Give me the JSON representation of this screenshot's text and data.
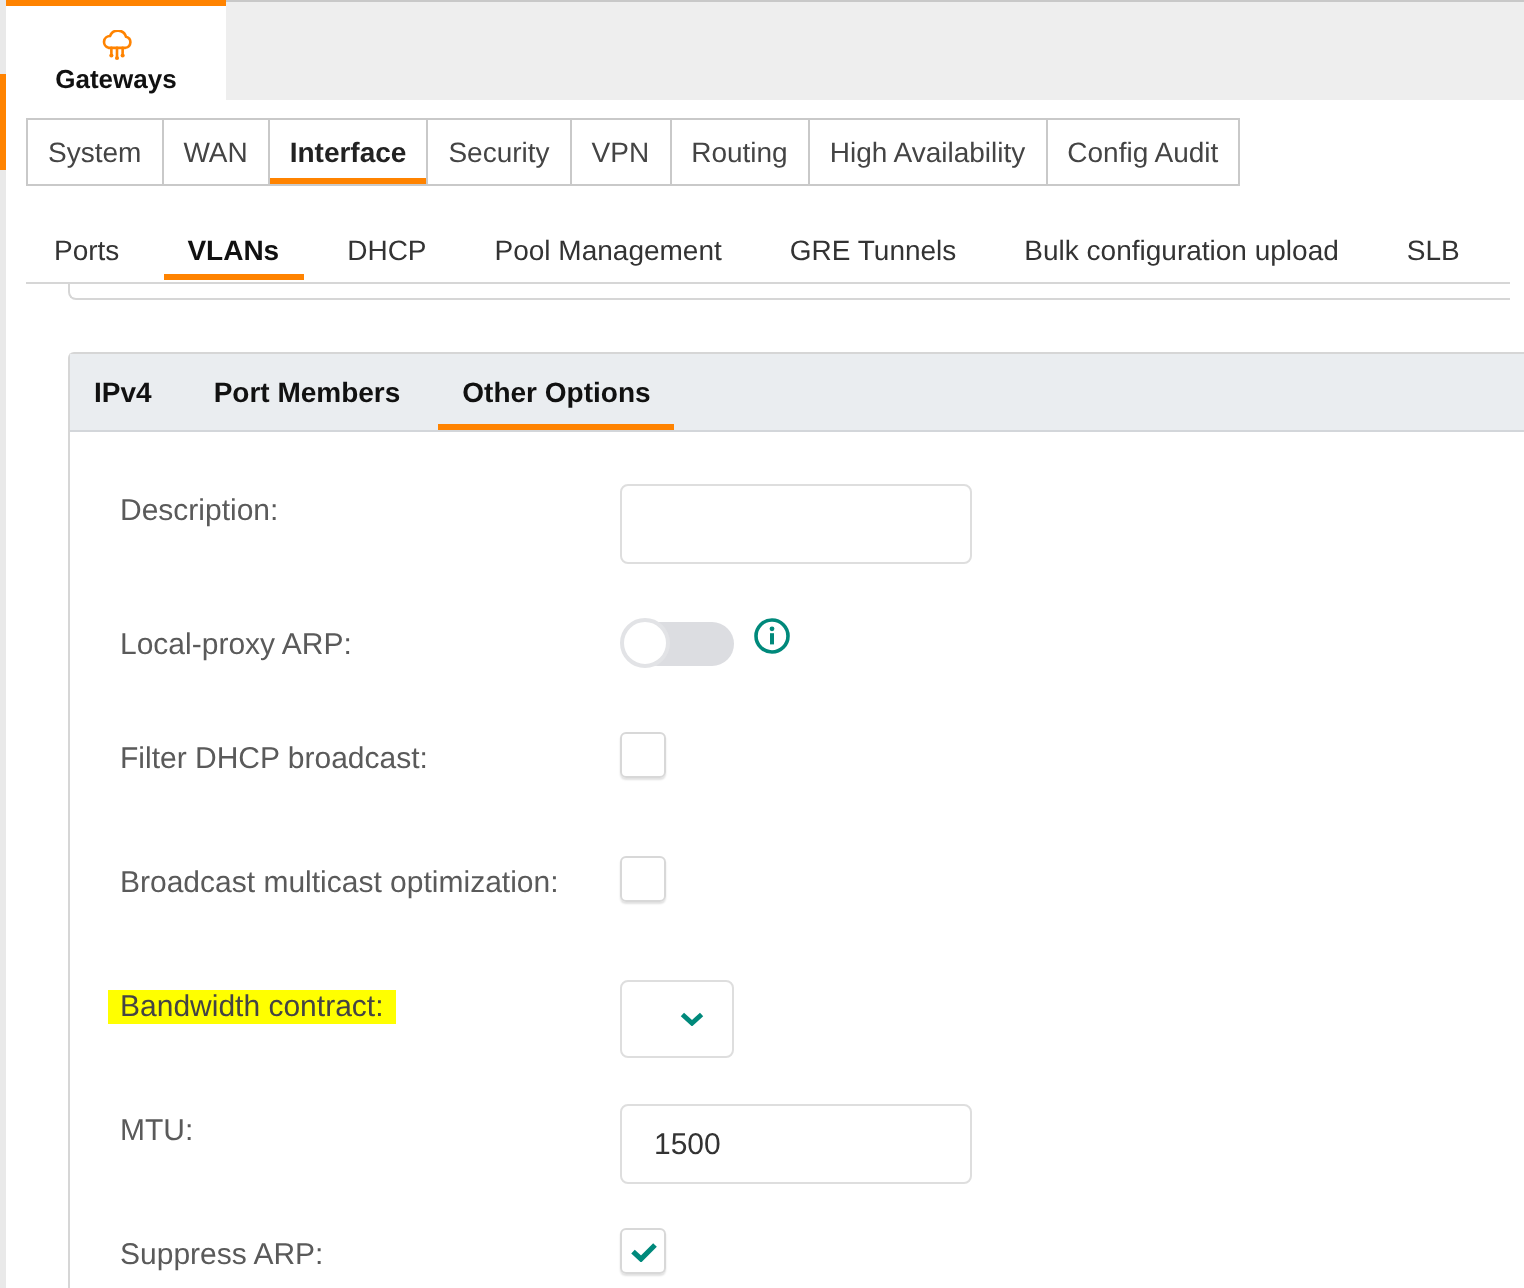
{
  "app_tabs": [
    {
      "label": "Gateways",
      "selected": true
    }
  ],
  "main_tabs": [
    {
      "label": "System",
      "selected": false
    },
    {
      "label": "WAN",
      "selected": false
    },
    {
      "label": "Interface",
      "selected": true
    },
    {
      "label": "Security",
      "selected": false
    },
    {
      "label": "VPN",
      "selected": false
    },
    {
      "label": "Routing",
      "selected": false
    },
    {
      "label": "High Availability",
      "selected": false
    },
    {
      "label": "Config Audit",
      "selected": false
    }
  ],
  "sub_tabs": [
    {
      "label": "Ports",
      "selected": false
    },
    {
      "label": "VLANs",
      "selected": true
    },
    {
      "label": "DHCP",
      "selected": false
    },
    {
      "label": "Pool Management",
      "selected": false
    },
    {
      "label": "GRE Tunnels",
      "selected": false
    },
    {
      "label": "Bulk configuration upload",
      "selected": false
    },
    {
      "label": "SLB",
      "selected": false
    }
  ],
  "section_tabs": [
    {
      "label": "IPv4",
      "selected": false
    },
    {
      "label": "Port Members",
      "selected": false
    },
    {
      "label": "Other Options",
      "selected": true
    }
  ],
  "fields": [
    {
      "kind": "text",
      "label": "Description:",
      "highlighted": false,
      "info": false
    },
    {
      "kind": "toggle",
      "label": "Local-proxy ARP:",
      "on": false,
      "highlighted": false,
      "info": true
    },
    {
      "kind": "checkbox",
      "label": "Filter DHCP broadcast:",
      "checked": false,
      "highlighted": false,
      "info": false
    },
    {
      "kind": "checkbox",
      "label": "Broadcast multicast optimization:",
      "checked": false,
      "highlighted": false,
      "info": false
    },
    {
      "kind": "dropdown",
      "label": "Bandwidth contract:",
      "highlighted": true,
      "info": false
    },
    {
      "kind": "text",
      "label": "MTU:",
      "value": "1500",
      "highlighted": false,
      "info": false
    },
    {
      "kind": "checkbox",
      "label": "Suppress ARP:",
      "checked": true,
      "highlighted": false,
      "info": false
    }
  ]
}
